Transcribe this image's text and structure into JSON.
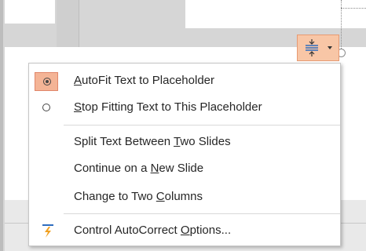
{
  "smart_tag": {
    "icon": "autofit-options-icon",
    "dropdown_icon": "chevron-down-icon"
  },
  "menu": {
    "items": [
      {
        "label_parts": [
          "",
          "A",
          "utoFit Text to Placeholder"
        ],
        "icon": "radio-selected-icon",
        "selected": true
      },
      {
        "label_parts": [
          "",
          "S",
          "top Fitting Text to This Placeholder"
        ],
        "icon": "radio-icon",
        "selected": false
      },
      {
        "label_parts": [
          "Split Text Between ",
          "T",
          "wo Slides"
        ]
      },
      {
        "label_parts": [
          "Continue on a ",
          "N",
          "ew Slide"
        ]
      },
      {
        "label_parts": [
          "Change to Two ",
          "C",
          "olumns"
        ]
      },
      {
        "label_parts": [
          "Control AutoCorrect ",
          "O",
          "ptions..."
        ],
        "icon": "autocorrect-lightning-icon"
      }
    ]
  },
  "colors": {
    "highlight": "#f4b496",
    "highlight_border": "#e0866a",
    "autocorrect_icon_blue": "#2e6dbf",
    "autocorrect_icon_orange": "#f0a020"
  }
}
